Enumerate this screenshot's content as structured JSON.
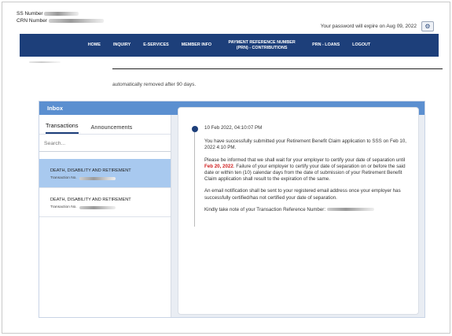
{
  "account": {
    "ss_label": "SS Number",
    "crn_label": "CRN Number"
  },
  "expiry_text": "Your password will expire on Aug 09, 2022",
  "nav": {
    "items": [
      "HOME",
      "INQUIRY",
      "E-SERVICES",
      "MEMBER INFO",
      "PAYMENT REFERENCE NUMBER (PRN) - CONTRIBUTIONS",
      "PRN - LOANS",
      "LOGOUT"
    ]
  },
  "notice": "automatically removed after 90 days.",
  "inbox": {
    "title": "Inbox",
    "tabs": [
      "Transactions",
      "Announcements"
    ],
    "search_placeholder": "Search...",
    "transactions": [
      {
        "title": "DEATH, DISABILITY AND RETIREMENT",
        "sub": "Transaction No."
      },
      {
        "title": "DEATH, DISABILITY AND RETIREMENT",
        "sub": "Transaction No."
      }
    ]
  },
  "message": {
    "timestamp": "10 Feb 2022, 04:10:07 PM",
    "p1": "You have successfully submitted your Retirement Benefit Claim application to SSS on Feb 10, 2022 4:10 PM.",
    "p2_before": "Please be informed that we shall wait for your employer to certify your date of separation until ",
    "p2_date": "Feb 20, 2022",
    "p2_after": ". Failure of your employer to certify your date of separation on or before the said date or within ten (10) calendar days from the date of submission of your Retirement Benefit Claim application shall result to the expiration of the same.",
    "p3": "An email notification shall be sent to your registered email address once your employer has successfully certified/has not certified your date of separation.",
    "p4": "Kindly take note of your Transaction Reference Number:"
  },
  "colors": {
    "nav_bg": "#1d3f7a",
    "inbox_header": "#5b8fd0",
    "selected_row": "#a8c9ef",
    "deadline_red": "#d02020"
  }
}
